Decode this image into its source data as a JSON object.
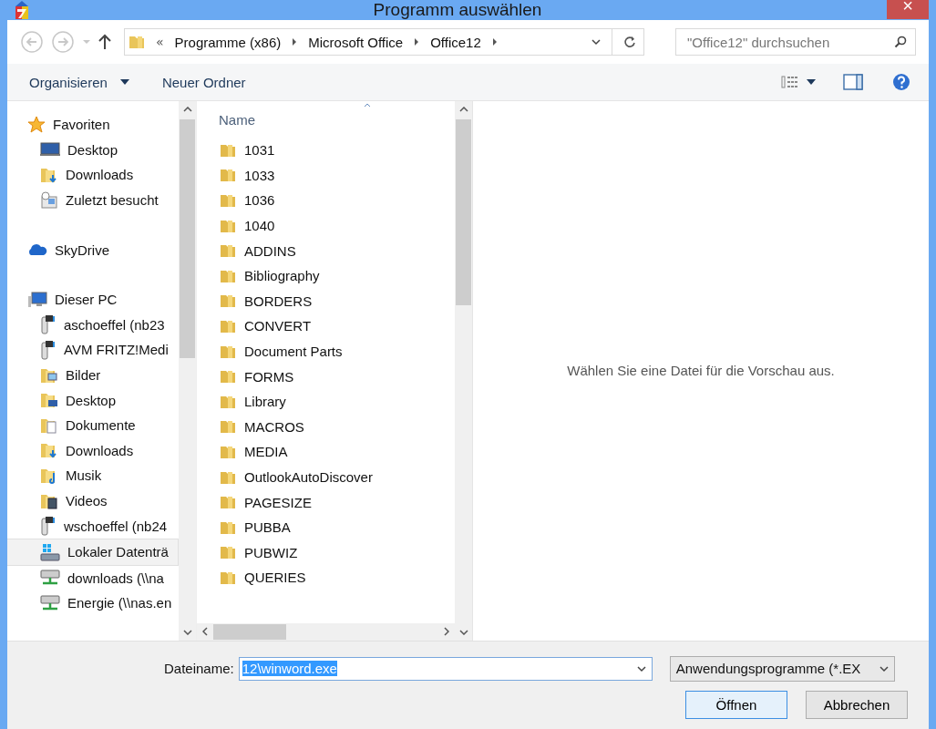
{
  "window": {
    "title": "Programm auswählen",
    "close": "×"
  },
  "address": {
    "overflow": "«",
    "crumbs": [
      "Programme (x86)",
      "Microsoft Office",
      "Office12"
    ]
  },
  "search": {
    "placeholder": "\"Office12\" durchsuchen"
  },
  "toolbar": {
    "organize": "Organisieren",
    "new_folder": "Neuer Ordner"
  },
  "sidebar": {
    "groups": [
      {
        "label": "Favoriten",
        "kind": "star",
        "items": [
          {
            "label": "Desktop",
            "kind": "desktop",
            "selected": false
          },
          {
            "label": "Downloads",
            "kind": "download",
            "selected": false
          },
          {
            "label": "Zuletzt besucht",
            "kind": "recent",
            "selected": false
          }
        ]
      },
      {
        "label": "SkyDrive",
        "kind": "cloud"
      },
      {
        "label": "Dieser PC",
        "kind": "pc",
        "items": [
          {
            "label": "aschoeffel (nb23",
            "kind": "media",
            "selected": false
          },
          {
            "label": "AVM FRITZ!Medi",
            "kind": "media",
            "selected": false
          },
          {
            "label": "Bilder",
            "kind": "pictures",
            "selected": false
          },
          {
            "label": "Desktop",
            "kind": "folder-desktop",
            "selected": false
          },
          {
            "label": "Dokumente",
            "kind": "documents",
            "selected": false
          },
          {
            "label": "Downloads",
            "kind": "download",
            "selected": false
          },
          {
            "label": "Musik",
            "kind": "music",
            "selected": false
          },
          {
            "label": "Videos",
            "kind": "videos",
            "selected": false
          },
          {
            "label": "wschoeffel (nb24",
            "kind": "media",
            "selected": false
          },
          {
            "label": "Lokaler Datenträ",
            "kind": "drive",
            "selected": true
          },
          {
            "label": "downloads (\\\\na",
            "kind": "network",
            "selected": false
          },
          {
            "label": "Energie (\\\\nas.en",
            "kind": "network",
            "selected": false
          }
        ]
      }
    ]
  },
  "file_list": {
    "column": "Name",
    "rows": [
      "1031",
      "1033",
      "1036",
      "1040",
      "ADDINS",
      "Bibliography",
      "BORDERS",
      "CONVERT",
      "Document Parts",
      "FORMS",
      "Library",
      "MACROS",
      "MEDIA",
      "OutlookAutoDiscover",
      "PAGESIZE",
      "PUBBA",
      "PUBWIZ",
      "QUERIES"
    ]
  },
  "preview": {
    "message": "Wählen Sie eine Datei für die Vorschau aus."
  },
  "footer": {
    "filename_label": "Dateiname:",
    "filename_value": "12\\winword.exe",
    "filter": "Anwendungsprogramme (*.EX",
    "buttons": [
      {
        "label": "Öffnen",
        "default": true
      },
      {
        "label": "Abbrechen",
        "default": false
      }
    ]
  }
}
